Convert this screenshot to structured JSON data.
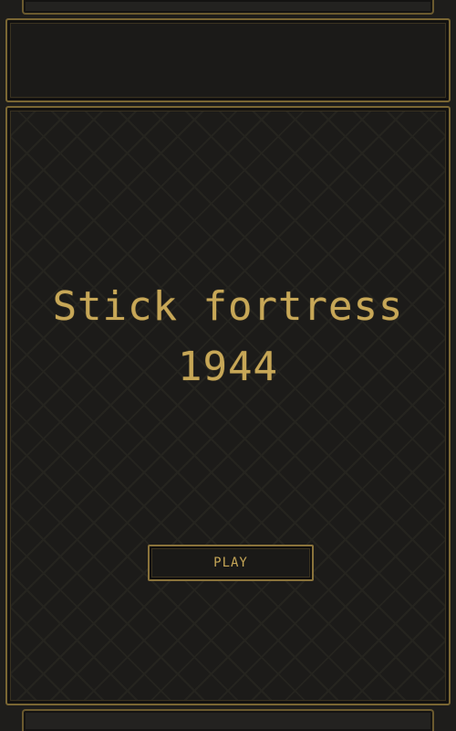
{
  "game": {
    "title_line_1": "Stick fortress",
    "title_line_2": "1944",
    "play_label": "PLAY"
  },
  "colors": {
    "accent_gold": "#c7a757",
    "border_gold": "#7a6633",
    "background": "#1c1b19"
  }
}
